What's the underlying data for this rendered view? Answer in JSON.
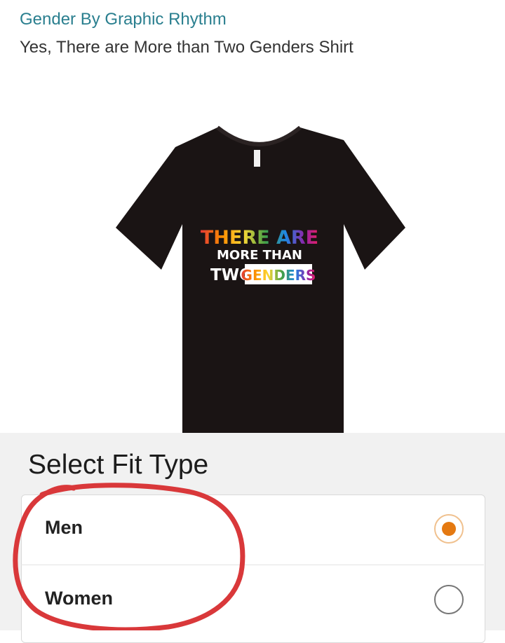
{
  "product": {
    "brand_link": "Gender By Graphic Rhythm",
    "title": "Yes, There are More than Two Genders Shirt"
  },
  "shirt_print": {
    "line1": "THERE ARE",
    "line2": "MORE THAN",
    "line3_plain": "TWO",
    "line3_highlight": "GENDERS",
    "rainbow_colors": [
      "#e53935",
      "#fb8c00",
      "#fdd835",
      "#43a047",
      "#1e88e5",
      "#8e24aa",
      "#e91e63"
    ]
  },
  "fit_selector": {
    "heading": "Select Fit Type",
    "options": [
      {
        "label": "Men",
        "selected": true
      },
      {
        "label": "Women",
        "selected": false
      }
    ],
    "accent_color": "#e47911"
  },
  "annotation": {
    "color": "#d9383a"
  }
}
